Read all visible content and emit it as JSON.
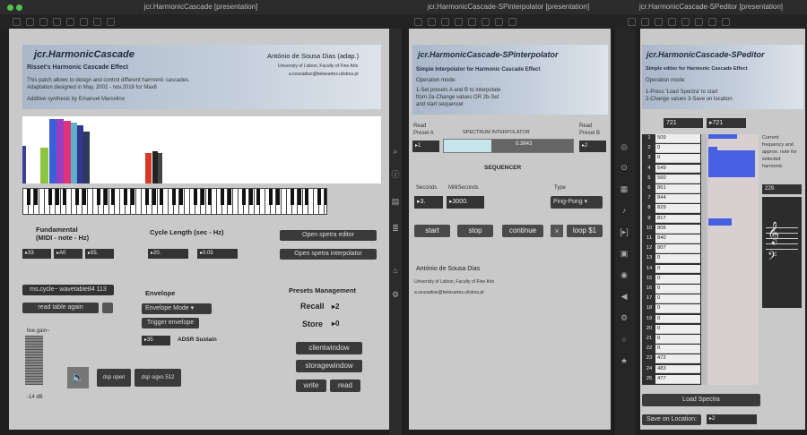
{
  "win1": {
    "title": "jcr.HarmonicCascade [presentation]",
    "header": {
      "title": "jcr.HarmonicCascade",
      "subtitle": "Risset's Harmonic Cascade Effect",
      "author": "António de Sousa Dias (adap.)",
      "affil": "University of Lisbon, Faculty of Fine Arts",
      "email": "a.sousadias@belasartes.ulisboa.pt",
      "desc1": "This patch allows to design and control different harmonic cascades.",
      "desc2": "Adaptation designed in May, 2002 - nov.2018 for Max8",
      "credit": "Additive synthesis by Emanuel Marcelino"
    },
    "fundamental": {
      "label": "Fundamental",
      "sub": "(MIDI - note - Hz)",
      "midi": "33",
      "note": "A0",
      "hz": "55."
    },
    "cycle": {
      "label": "Cycle Length (sec - Hz)",
      "sec": "20.",
      "hz": "0.05"
    },
    "buttons": {
      "spectra_editor": "Open spetra editor",
      "spectra_interp": "Open spetra interpolator",
      "wavetable": "ms.cycle~ wavetable84 113",
      "read_table": "read table again",
      "trigger": "Trigger envelope",
      "dsp_open": "dsp open",
      "dsp_sigvs": "dsp sigvs 512",
      "clientwindow": "clientwindow",
      "storagewindow": "storagewindow",
      "write": "write",
      "read": "read"
    },
    "envelope": {
      "label": "Envelope",
      "mode": "Envelope Mode",
      "sustain_val": "35",
      "sustain_label": "ADSR Sustain"
    },
    "presets": {
      "label": "Presets Management",
      "recall": "Recall",
      "recall_val": "2",
      "store": "Store",
      "store_val": "0"
    },
    "gain": {
      "label": "live.gain~",
      "db": "-14 dB"
    }
  },
  "win2": {
    "title": "jcr.HarmonicCascade-SPinterpolator [presentation]",
    "header": {
      "title": "jcr.HarmonicCascade-SPinterpolator",
      "subtitle": "Simple Interpolator for Harmonic Cascade Effect",
      "mode": "Operation mode:",
      "l1": "1-Set presets A and B to interpolate",
      "l2": "from   2a-Change values   OR 2b-Set",
      "l3": "and start sequencer"
    },
    "readA": "Read Preset A",
    "readB": "Read Preset B",
    "spectrum": "SPECTRUM INTERPOLATOR",
    "valA": "1",
    "valB": "2",
    "interp": "0.3643",
    "sequencer": "SEQUENCER",
    "seconds": "Seconds",
    "ms": "MilliSeconds",
    "type": "Type",
    "sec_val": "3.",
    "ms_val": "3000.",
    "type_val": "Ping-Pong",
    "start": "start",
    "stop": "stop",
    "continue": "continue",
    "loop": "loop $1",
    "author": "António de Sousa Dias",
    "affil": "University of Lisbon, Faculty of Fine Arts",
    "email": "a.sousadias@belasartes.ulisboa.pt"
  },
  "win3": {
    "title": "jcr.HarmonicCascade-SPeditor [presentation]",
    "header": {
      "title": "jcr.HarmonicCascade-SPeditor",
      "subtitle": "Simple editor for Harmonic Cascade Effect",
      "mode": "Operation mode:",
      "l1": "1-Press 'Load Spectra' to start",
      "l2": "2-Change values   3-Save on location"
    },
    "num_a": "721",
    "num_b": "721",
    "side_label": "Current frequency and approx. note for selected harmonic",
    "side_val": "229.",
    "rows": [
      [
        "1",
        "509"
      ],
      [
        "2",
        "0"
      ],
      [
        "3",
        "0"
      ],
      [
        "4",
        "549"
      ],
      [
        "5",
        "560"
      ],
      [
        "6",
        "861"
      ],
      [
        "7",
        "844"
      ],
      [
        "8",
        "829"
      ],
      [
        "9",
        "817"
      ],
      [
        "10",
        "806"
      ],
      [
        "11",
        "840"
      ],
      [
        "12",
        "807"
      ],
      [
        "13",
        "0"
      ],
      [
        "14",
        "0"
      ],
      [
        "15",
        "0"
      ],
      [
        "16",
        "0"
      ],
      [
        "17",
        "0"
      ],
      [
        "18",
        "0"
      ],
      [
        "19",
        "0"
      ],
      [
        "20",
        "0"
      ],
      [
        "21",
        "0"
      ],
      [
        "22",
        "0"
      ],
      [
        "23",
        "472"
      ],
      [
        "24",
        "483"
      ],
      [
        "25",
        "477"
      ]
    ],
    "load": "Load Spectra",
    "save": "Save on Location:",
    "save_val": "2"
  },
  "colors": {
    "bg": "#1b1b1b",
    "panel": "#cfcfcf",
    "header": "#b9c4d3",
    "blue": "#4760e3"
  }
}
